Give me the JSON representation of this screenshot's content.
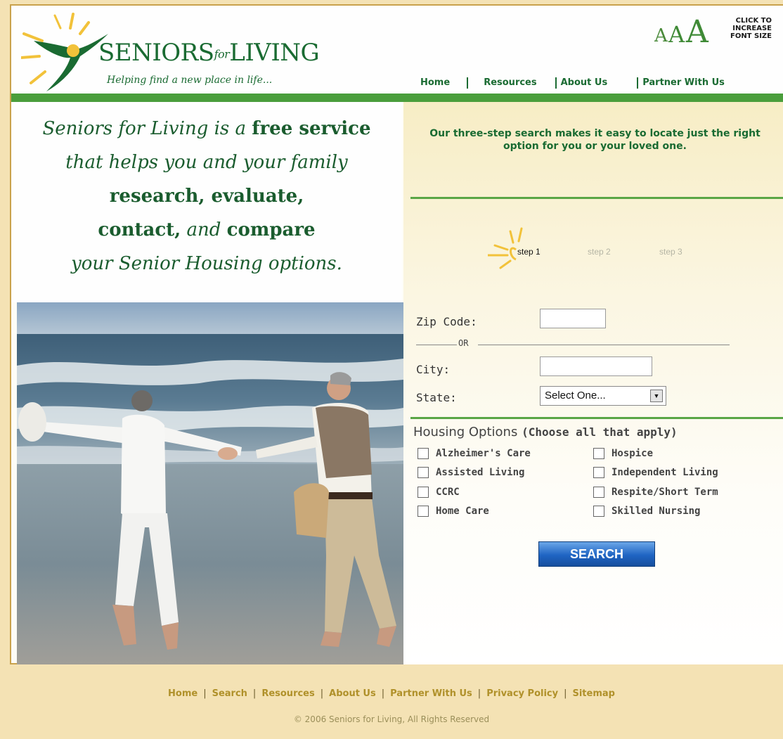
{
  "header": {
    "logo_main": "SENIORS",
    "logo_for": "for",
    "logo_end": "LIVING",
    "tagline": "Helping find a new place in life...",
    "font_size_letters": "AAA",
    "font_size_label": "CLICK TO\nINCREASE\nFONT SIZE"
  },
  "nav": {
    "items": [
      {
        "label": "Home"
      },
      {
        "label": "Resources"
      },
      {
        "label": "About Us"
      },
      {
        "label": "Partner With Us"
      }
    ]
  },
  "hero": {
    "line1a": "Seniors for Living is a ",
    "line1b": "free service",
    "line2": "that helps you and your family",
    "line3": "research, evaluate,",
    "line4a": "contact,",
    "line4b": " and ",
    "line4c": "compare",
    "line5": "your Senior Housing options."
  },
  "search": {
    "intro": "Our three-step search makes it easy to locate just the right option for you or your loved one.",
    "steps": [
      {
        "label": "step 1",
        "active": true
      },
      {
        "label": "step 2",
        "active": false
      },
      {
        "label": "step 3",
        "active": false
      }
    ],
    "zip_label": "Zip Code:",
    "zip_value": "",
    "or_label": "OR",
    "city_label": "City:",
    "city_value": "",
    "state_label": "State:",
    "state_selected": "Select One...",
    "housing_title": "Housing Options",
    "housing_sub": "(Choose all that apply)",
    "options_left": [
      "Alzheimer's Care",
      "Assisted Living",
      "CCRC",
      "Home Care"
    ],
    "options_right": [
      "Hospice",
      "Independent Living",
      "Respite/Short Term",
      "Skilled Nursing"
    ],
    "button_label": "SEARCH"
  },
  "footer": {
    "links": [
      "Home",
      "Search",
      "Resources",
      "About Us",
      "Partner With Us",
      "Privacy Policy",
      "Sitemap"
    ],
    "copyright": "© 2006 Seniors for Living, All Rights Reserved"
  },
  "colors": {
    "brand_green": "#1a6b32",
    "bar_green": "#4a9e3c",
    "page_bg": "#f4e2b4",
    "button_blue": "#1f64c3"
  }
}
